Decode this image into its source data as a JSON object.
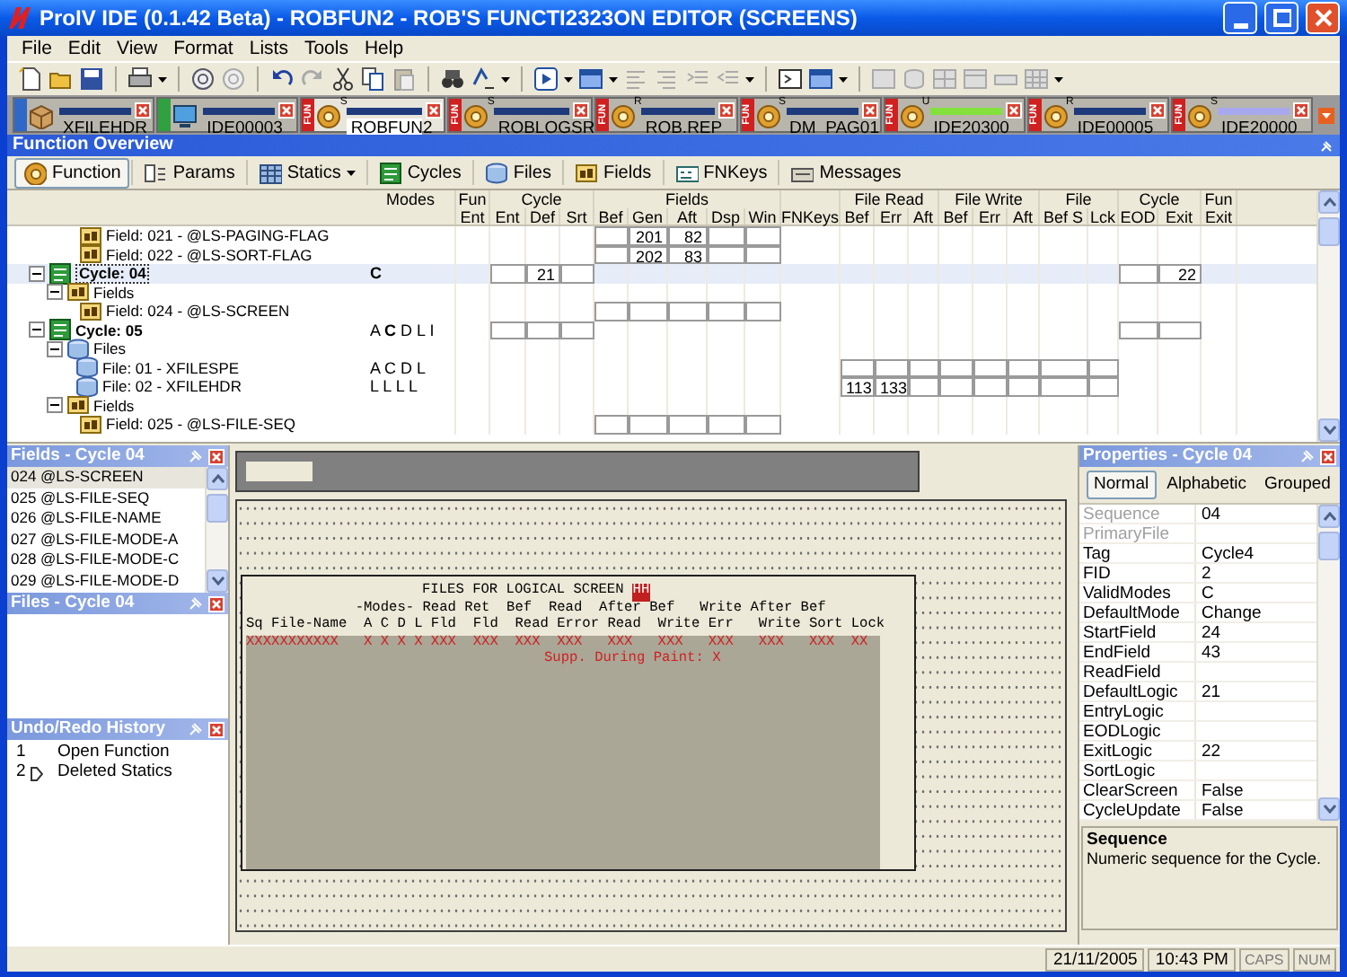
{
  "window": {
    "title": "ProIV IDE (0.1.42 Beta) - ROBFUN2 - ROB'S FUNCTI2323ON EDITOR (SCREENS)"
  },
  "menu": [
    "File",
    "Edit",
    "View",
    "Format",
    "Lists",
    "Tools",
    "Help"
  ],
  "doc_tabs": [
    {
      "label": "XFILEHDR",
      "kind": "file",
      "color": "#1f3b7c",
      "selected": false
    },
    {
      "label": "IDE00003",
      "kind": "screen",
      "color": "#1f3b7c",
      "selected": false
    },
    {
      "label": "ROBFUN2",
      "kind": "function",
      "tag": "FUN",
      "flag": "S",
      "color": "#1f3b7c",
      "selected": true
    },
    {
      "label": "ROBLOGSR",
      "kind": "function",
      "tag": "FUN",
      "flag": "S",
      "color": "#1f3b7c",
      "selected": false
    },
    {
      "label": "ROB.REP",
      "kind": "function",
      "tag": "FUN",
      "flag": "R",
      "color": "#1f3b7c",
      "selected": false
    },
    {
      "label": "DM_PAG01",
      "kind": "function",
      "tag": "FUN",
      "flag": "S",
      "color": "#1f3b7c",
      "selected": false
    },
    {
      "label": "IDE20300",
      "kind": "function",
      "tag": "FUN",
      "flag": "U",
      "color": "#84e03c",
      "selected": false
    },
    {
      "label": "IDE00005",
      "kind": "function",
      "tag": "FUN",
      "flag": "R",
      "color": "#1f3b7c",
      "selected": false
    },
    {
      "label": "IDE20000",
      "kind": "function",
      "tag": "FUN",
      "flag": "S",
      "color": "#a8a8ee",
      "selected": false
    }
  ],
  "overview": {
    "title": "Function Overview",
    "sections": [
      {
        "label": "Function",
        "kind": "button",
        "selected": true
      },
      {
        "label": "Params",
        "kind": "button",
        "selected": false
      },
      {
        "label": "Statics",
        "kind": "menu",
        "selected": false
      },
      {
        "label": "Cycles",
        "kind": "button",
        "selected": false
      },
      {
        "label": "Files",
        "kind": "button",
        "selected": false
      },
      {
        "label": "Fields",
        "kind": "button",
        "selected": false
      },
      {
        "label": "FNKeys",
        "kind": "button",
        "selected": false
      },
      {
        "label": "Messages",
        "kind": "button",
        "selected": false
      }
    ],
    "groups": [
      {
        "label": "Modes"
      },
      {
        "label": "Fun",
        "columns": [
          "Ent"
        ]
      },
      {
        "label": "Cycle",
        "columns": [
          "Ent",
          "Def",
          "Srt"
        ]
      },
      {
        "label": "Fields",
        "columns": [
          "Bef",
          "Gen",
          "Aft",
          "Dsp",
          "Win"
        ]
      },
      {
        "columns": [
          "FNKeys"
        ]
      },
      {
        "label": "File Read",
        "columns": [
          "Bef",
          "Err",
          "Aft"
        ]
      },
      {
        "label": "File Write",
        "columns": [
          "Bef",
          "Err",
          "Aft"
        ]
      },
      {
        "label": "File",
        "columns": [
          "Bef S",
          "Lck"
        ]
      },
      {
        "label": "Cycle",
        "columns": [
          "EOD",
          "Exit"
        ]
      },
      {
        "label": "Fun",
        "columns": [
          "Exit"
        ]
      }
    ],
    "rows": [
      {
        "kind": "field",
        "label": "Field: 021 - @LS-PAGING-FLAG",
        "selected": false,
        "editable": {
          "fields": true
        },
        "cells": {
          "fields_gen": "201",
          "fields_aft": "82"
        }
      },
      {
        "kind": "field",
        "label": "Field: 022 - @LS-SORT-FLAG",
        "selected": false,
        "editable": {
          "fields": true
        },
        "cells": {
          "fields_gen": "202",
          "fields_aft": "83"
        }
      },
      {
        "kind": "cycle",
        "label": "Cycle: 04",
        "selected": true,
        "expanded": true,
        "modes": "**C**",
        "editable": {
          "cycle": true,
          "cycle_end": true
        },
        "cells": {
          "cycle_def": "21",
          "cycle_exit": "22"
        },
        "children": [
          {
            "kind": "fields",
            "label": "Fields",
            "selected": false,
            "expanded": true,
            "children": [
              {
                "kind": "field",
                "label": "Field: 024 - @LS-SCREEN",
                "selected": false,
                "editable": {
                  "fields": true
                }
              }
            ]
          }
        ]
      },
      {
        "kind": "cycle",
        "label": "Cycle: 05",
        "selected": false,
        "expanded": true,
        "modes": "A **C** D L I",
        "editable": {
          "cycle": true,
          "cycle_end": true
        },
        "children": [
          {
            "kind": "files",
            "label": "Files",
            "selected": false,
            "expanded": true,
            "children": [
              {
                "kind": "file",
                "label": "File: 01 - XFILESPE",
                "selected": false,
                "modes": "A C D L",
                "editable": {
                  "file": true
                }
              },
              {
                "kind": "file",
                "label": "File: 02 - XFILEHDR",
                "selected": false,
                "modes": "L L L L",
                "editable": {
                  "file": true
                },
                "cells": {
                  "read_bef": "113",
                  "read_err": "133"
                }
              }
            ]
          },
          {
            "kind": "fields",
            "label": "Fields",
            "selected": false,
            "expanded": true,
            "children": [
              {
                "kind": "field",
                "label": "Field: 025 - @LS-FILE-SEQ",
                "selected": false,
                "editable": {
                  "fields": true
                }
              }
            ]
          }
        ]
      }
    ]
  },
  "fields_panel": {
    "title": "Fields - Cycle 04",
    "items": [
      {
        "label": "024 @LS-SCREEN",
        "selected": true
      },
      {
        "label": "025 @LS-FILE-SEQ",
        "selected": false
      },
      {
        "label": "026 @LS-FILE-NAME",
        "selected": false
      },
      {
        "label": "027 @LS-FILE-MODE-A",
        "selected": false
      },
      {
        "label": "028 @LS-FILE-MODE-C",
        "selected": false
      },
      {
        "label": "029 @LS-FILE-MODE-D",
        "selected": false
      }
    ]
  },
  "files_panel": {
    "title": "Files - Cycle 04"
  },
  "history_panel": {
    "title": "Undo/Redo History",
    "items": [
      {
        "number": "1",
        "label": "Open Function",
        "current": false
      },
      {
        "number": "2",
        "label": "Deleted Statics",
        "current": true
      }
    ]
  },
  "designer": {
    "heading": "FILES FOR LOGICAL SCREEN",
    "heading_field": "HH",
    "label_lines": [
      "             -Modes- Read Ret  Bef  Read  After Bef   Write After Bef",
      "Sq File-Name  A C D L Fld  Fld  Read Error Read  Write Err   Write Sort Lock"
    ],
    "field_line": "XXXXXXXXXXX   X X X X XXX  XXX  XXX  XXX   XXX   XXX   XXX   XXX   XXX  XX",
    "paint_note": "Supp. During Paint: X"
  },
  "properties": {
    "title": "Properties - Cycle 04",
    "tabs": [
      {
        "label": "Normal",
        "selected": true
      },
      {
        "label": "Alphabetic",
        "selected": false
      },
      {
        "label": "Grouped",
        "selected": false
      }
    ],
    "rows": [
      {
        "name": "Sequence",
        "value": "04",
        "disabled": true
      },
      {
        "name": "PrimaryFile",
        "disabled": true
      },
      {
        "name": "Tag",
        "value": "Cycle4",
        "disabled": false
      },
      {
        "name": "FID",
        "value": "2",
        "disabled": false
      },
      {
        "name": "ValidModes",
        "value": "C",
        "disabled": false
      },
      {
        "name": "DefaultMode",
        "value": "Change",
        "disabled": false
      },
      {
        "name": "StartField",
        "value": "24",
        "disabled": false
      },
      {
        "name": "EndField",
        "value": "43",
        "disabled": false
      },
      {
        "name": "ReadField",
        "disabled": false
      },
      {
        "name": "DefaultLogic",
        "value": "21",
        "disabled": false
      },
      {
        "name": "EntryLogic",
        "disabled": false
      },
      {
        "name": "EODLogic",
        "disabled": false
      },
      {
        "name": "ExitLogic",
        "value": "22",
        "disabled": false
      },
      {
        "name": "SortLogic",
        "disabled": false
      },
      {
        "name": "ClearScreen",
        "value": "False",
        "disabled": false
      },
      {
        "name": "CycleUpdate",
        "value": "False",
        "disabled": false
      }
    ],
    "description": {
      "title": "Sequence",
      "text": "Numeric sequence for the Cycle."
    }
  },
  "status_bar": {
    "date": "21/11/2005",
    "time": "10:43 PM",
    "indicators": [
      {
        "label": "CAPS",
        "on": false
      },
      {
        "label": "NUM",
        "on": false
      }
    ]
  }
}
